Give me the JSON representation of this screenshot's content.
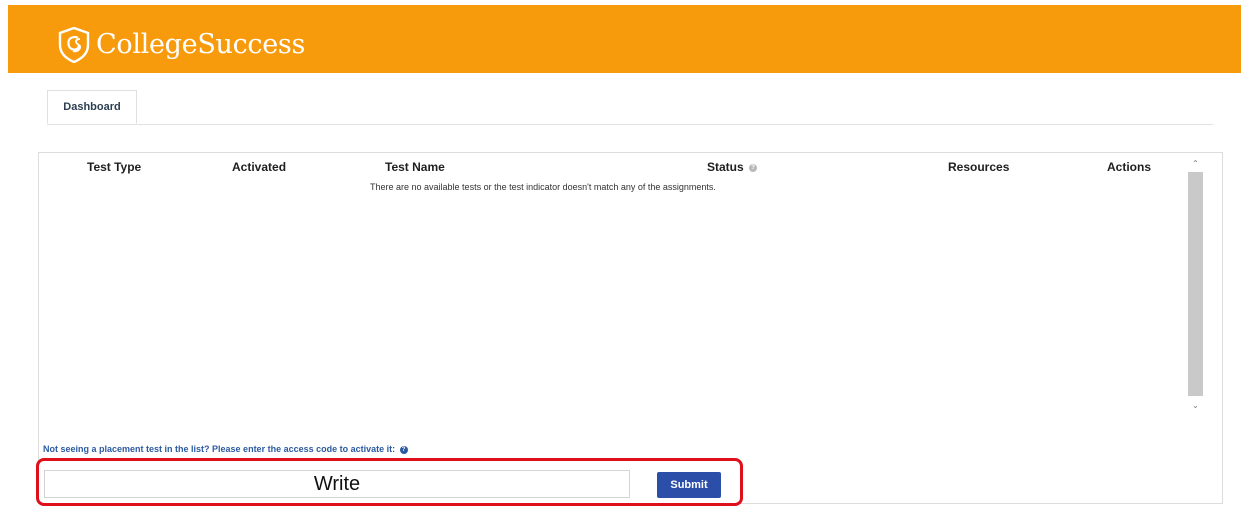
{
  "header": {
    "brand": "CollegeSuccess",
    "logo_icon": "shield-cs-logo-icon",
    "bg_color": "#f79b0c"
  },
  "tabs": [
    {
      "label": "Dashboard",
      "active": true
    }
  ],
  "table": {
    "columns": [
      "Test Type",
      "Activated",
      "Test Name",
      "Status",
      "Resources",
      "Actions"
    ],
    "status_info_icon": "info-icon",
    "empty_message": "There are no available tests or the test indicator doesn't match any of the assignments."
  },
  "access_code": {
    "prompt": "Not seeing a placement test in the list? Please enter the access code to activate it:",
    "prompt_icon": "question-icon",
    "input_value": "Write",
    "submit_label": "Submit",
    "highlight_color": "#e0101b",
    "button_color": "#2b4fa8"
  }
}
